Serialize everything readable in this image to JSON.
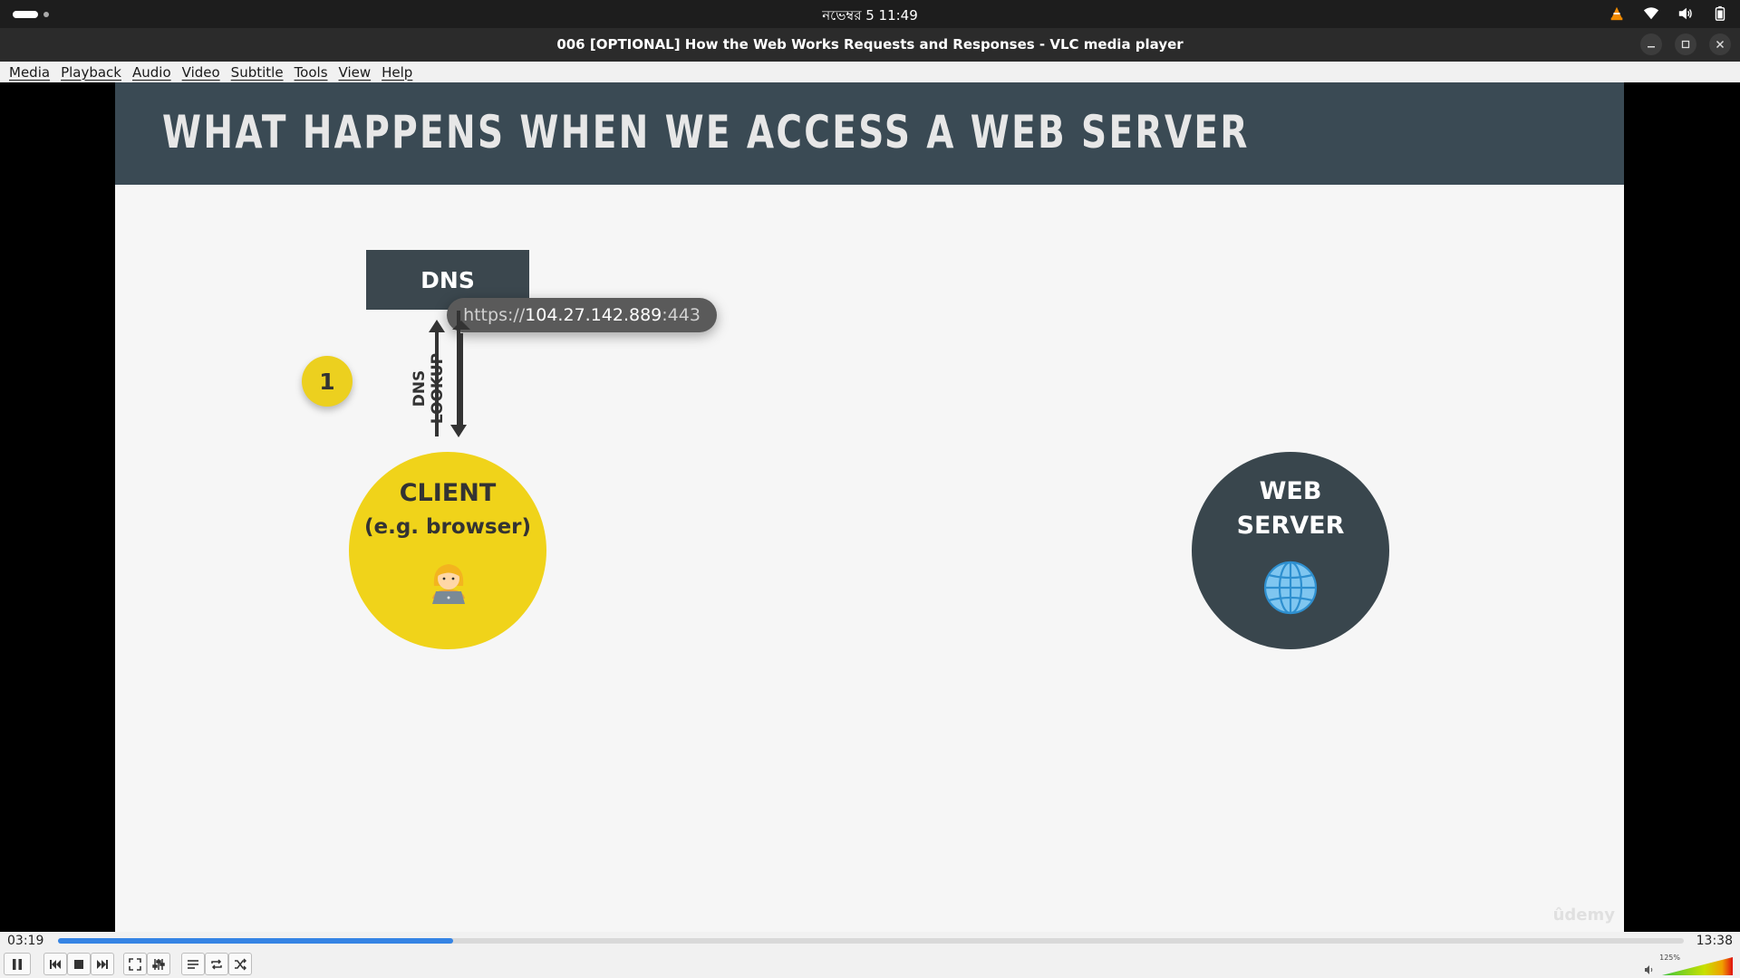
{
  "topbar": {
    "clock": "নভেম্বর 5  11:49",
    "tray_icons": [
      "vlc-tray-icon",
      "wifi-icon",
      "volume-icon",
      "battery-icon"
    ]
  },
  "window": {
    "title": "006 [OPTIONAL] How the Web Works Requests and Responses - VLC media player"
  },
  "menu": [
    "Media",
    "Playback",
    "Audio",
    "Video",
    "Subtitle",
    "Tools",
    "View",
    "Help"
  ],
  "slide": {
    "title": "WHAT HAPPENS WHEN WE ACCESS A WEB SERVER",
    "dns_label": "DNS",
    "url_scheme": "https://",
    "url_host": "104.27.142.889",
    "url_port": ":443",
    "step_number": "1",
    "dns_lookup_label": "DNS LOOKUP",
    "client_title": "CLIENT",
    "client_subtitle": "(e.g. browser)",
    "server_line1": "WEB",
    "server_line2": "SERVER",
    "watermark": "ûdemy",
    "colors": {
      "header": "#3a4a54",
      "client": "#f0d31a",
      "server": "#39464d"
    }
  },
  "player": {
    "elapsed": "03:19",
    "total": "13:38",
    "progress": 0.243,
    "volume_label": "125%",
    "volume_level": 1.25,
    "accent": "#3584e4"
  }
}
